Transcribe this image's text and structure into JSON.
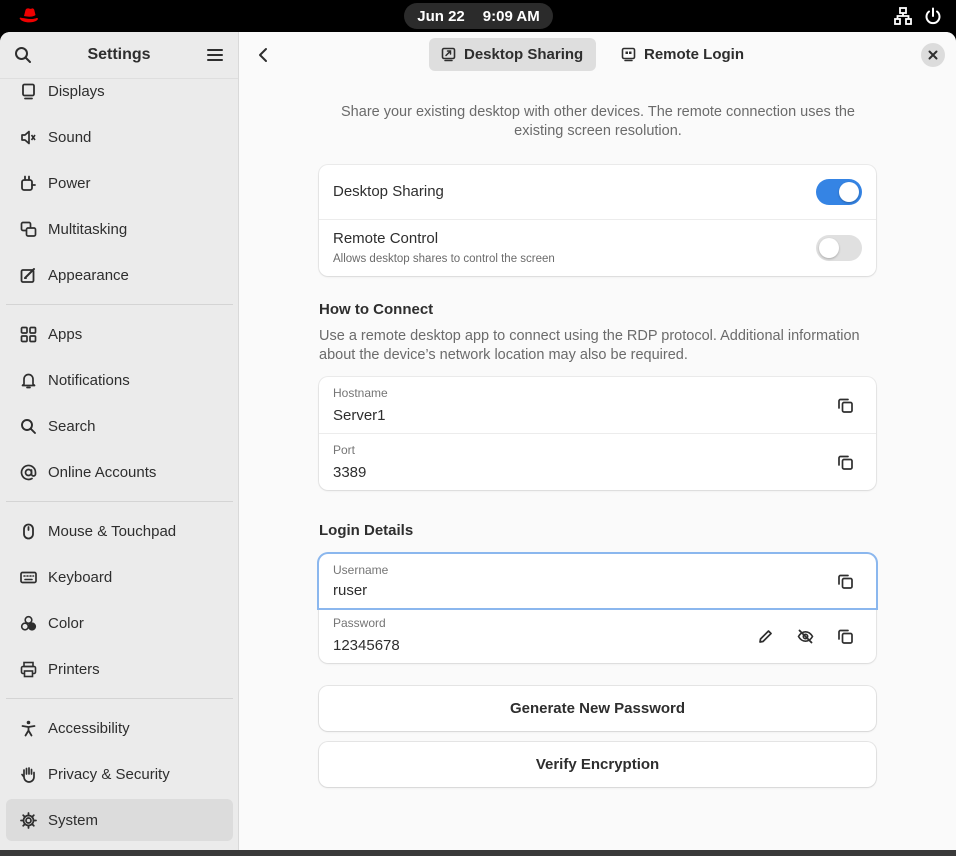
{
  "topbar": {
    "date": "Jun 22",
    "time": "9:09 AM"
  },
  "sidebar": {
    "title": "Settings",
    "items": [
      {
        "label": "Displays",
        "icon": "display-icon"
      },
      {
        "label": "Sound",
        "icon": "speaker-icon"
      },
      {
        "label": "Power",
        "icon": "power-plug-icon"
      },
      {
        "label": "Multitasking",
        "icon": "multitasking-icon"
      },
      {
        "label": "Appearance",
        "icon": "appearance-icon"
      },
      {
        "label": "Apps",
        "icon": "apps-grid-icon"
      },
      {
        "label": "Notifications",
        "icon": "bell-icon"
      },
      {
        "label": "Search",
        "icon": "search-icon"
      },
      {
        "label": "Online Accounts",
        "icon": "at-sign-icon"
      },
      {
        "label": "Mouse & Touchpad",
        "icon": "mouse-icon"
      },
      {
        "label": "Keyboard",
        "icon": "keyboard-icon"
      },
      {
        "label": "Color",
        "icon": "color-icon"
      },
      {
        "label": "Printers",
        "icon": "printer-icon"
      },
      {
        "label": "Accessibility",
        "icon": "accessibility-icon"
      },
      {
        "label": "Privacy & Security",
        "icon": "hand-icon"
      },
      {
        "label": "System",
        "icon": "gear-icon"
      }
    ],
    "active": "System"
  },
  "header": {
    "tabs": [
      {
        "label": "Desktop Sharing",
        "active": true
      },
      {
        "label": "Remote Login",
        "active": false
      }
    ]
  },
  "intro": "Share your existing desktop with other devices. The remote connection uses the existing screen resolution.",
  "sharing": {
    "desktop_sharing_label": "Desktop Sharing",
    "desktop_sharing_on": true,
    "remote_control_label": "Remote Control",
    "remote_control_sub": "Allows desktop shares to control the screen",
    "remote_control_on": false
  },
  "how_to_connect": {
    "title": "How to Connect",
    "desc": "Use a remote desktop app to connect using the RDP protocol. Additional information about the device’s network location may also be required.",
    "hostname_label": "Hostname",
    "hostname_value": "Server1",
    "port_label": "Port",
    "port_value": "3389"
  },
  "login": {
    "title": "Login Details",
    "username_label": "Username",
    "username_value": "ruser",
    "password_label": "Password",
    "password_value": "12345678"
  },
  "buttons": {
    "generate": "Generate New Password",
    "verify": "Verify Encryption"
  },
  "colors": {
    "accent": "#3584e4",
    "focus_ring": "#8bb7ee",
    "logo_red": "#ee0000"
  }
}
